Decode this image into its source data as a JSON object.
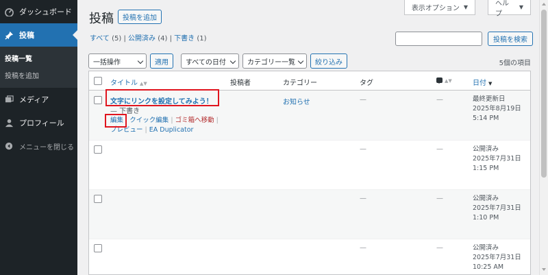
{
  "sidebar": {
    "items": [
      {
        "label": "ダッシュボード",
        "icon": "dashboard-icon"
      },
      {
        "label": "投稿",
        "icon": "pin-icon"
      },
      {
        "label": "メディア",
        "icon": "media-icon"
      },
      {
        "label": "プロフィール",
        "icon": "user-icon"
      },
      {
        "label": "メニューを閉じる",
        "icon": "collapse-icon"
      }
    ],
    "submenu": [
      "投稿一覧",
      "投稿を追加"
    ]
  },
  "header": {
    "screen_options": "表示オプション",
    "help": "ヘルプ",
    "title": "投稿",
    "add_new": "投稿を追加"
  },
  "filters": {
    "all": "すべて",
    "all_count": "(5)",
    "published": "公開済み",
    "published_count": "(4)",
    "drafts": "下書き",
    "drafts_count": "(1)",
    "search_button": "投稿を検索",
    "search_value": "",
    "bulk_action": "一括操作",
    "apply": "適用",
    "dates": "すべての日付",
    "categories": "カテゴリー一覧",
    "filter": "絞り込み",
    "items_count": "5個の項目"
  },
  "table": {
    "columns": {
      "title": "タイトル",
      "author": "投稿者",
      "categories": "カテゴリー",
      "tags": "タグ",
      "date": "日付"
    },
    "rows": [
      {
        "title": "文字にリンクを設定してみよう！",
        "state": "— 下書き",
        "author": "",
        "category": "お知らせ",
        "tags": "—",
        "comments": "—",
        "status": "最終更新日",
        "date": "2025年8月19日",
        "time": "5:14 PM",
        "actions": {
          "edit": "編集",
          "quick_edit": "クイック編集",
          "trash": "ゴミ箱へ移動",
          "preview": "プレビュー",
          "duplicator": "EA Duplicator"
        }
      },
      {
        "title": "",
        "tags": "—",
        "comments": "—",
        "status": "公開済み",
        "date": "2025年7月31日",
        "time": "1:15 PM"
      },
      {
        "title": "",
        "tags": "—",
        "comments": "—",
        "status": "公開済み",
        "date": "2025年7月31日",
        "time": "1:10 PM"
      },
      {
        "title": "",
        "tags": "—",
        "comments": "—",
        "status": "公開済み",
        "date": "2025年7月31日",
        "time": "10:25 AM"
      }
    ]
  },
  "colors": {
    "accent": "#2271b1",
    "sidebar_bg": "#1d2327",
    "highlight_box": "#e0141e",
    "trash": "#b32d2e"
  }
}
